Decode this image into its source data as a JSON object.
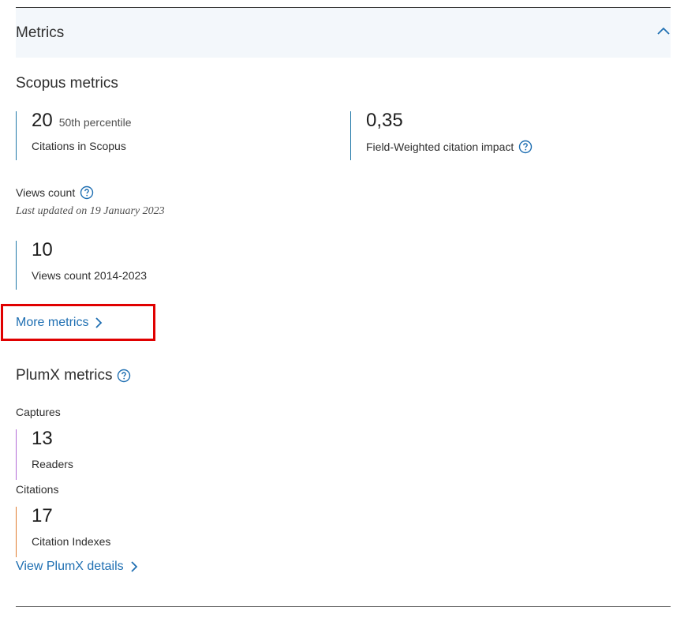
{
  "header": {
    "title": "Metrics",
    "toggle_icon": "chevron-up-icon"
  },
  "scopus": {
    "section_title": "Scopus metrics",
    "citations": {
      "value": "20",
      "percentile": "50th percentile",
      "label": "Citations in Scopus"
    },
    "fwci": {
      "value": "0,35",
      "label": "Field-Weighted citation impact",
      "help_icon": "question-circle-icon"
    },
    "views": {
      "title": "Views count",
      "updated": "Last updated on 19 January 2023",
      "value": "10",
      "label": "Views count 2014-2023"
    },
    "more_link": "More metrics"
  },
  "plumx": {
    "section_title": "PlumX metrics",
    "captures": {
      "category": "Captures",
      "value": "13",
      "label": "Readers",
      "accent": "#b36bd6"
    },
    "citations": {
      "category": "Citations",
      "value": "17",
      "label": "Citation Indexes",
      "accent": "#e07b2e"
    },
    "details_link": "View PlumX details"
  },
  "colors": {
    "link": "#1f6fb2",
    "scopus_accent": "#1f78a8",
    "header_bg": "#f3f7fb",
    "highlight": "#e00000"
  }
}
